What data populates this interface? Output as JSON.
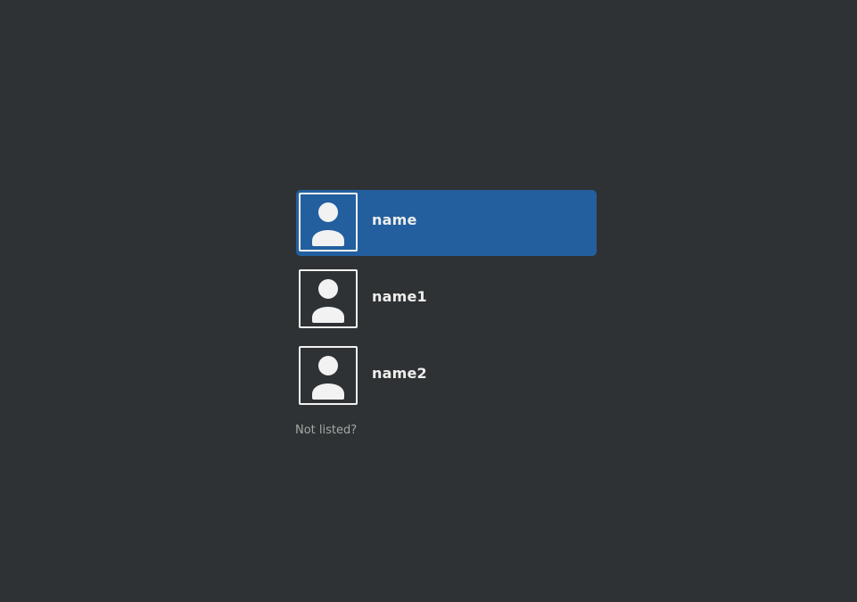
{
  "login": {
    "users": [
      {
        "name": "name",
        "selected": true
      },
      {
        "name": "name1",
        "selected": false
      },
      {
        "name": "name2",
        "selected": false
      }
    ],
    "not_listed_label": "Not listed?"
  },
  "icons": {
    "avatar": "user-avatar-icon"
  },
  "colors": {
    "background": "#2f3234",
    "selected_row": "#235f9f",
    "text": "#eeeeec",
    "muted_text": "#a5a8a4"
  }
}
